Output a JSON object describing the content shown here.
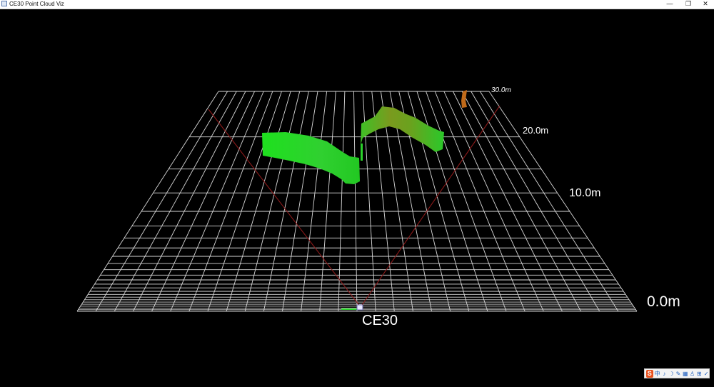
{
  "window": {
    "title": "CE30 Point Cloud Viz",
    "minimize_glyph": "—",
    "maximize_glyph": "❐",
    "close_glyph": "✕"
  },
  "viz": {
    "sensor_label": "CE30",
    "range_labels": [
      "0.0m",
      "10.0m",
      "20.0m",
      "30.0m"
    ],
    "colors": {
      "background": "#000000",
      "grid": "#d8d8d8",
      "fov_lines": "#8b1a1a",
      "points_near": "#22dd22",
      "points_mid": "#6aa81a",
      "points_far": "#c06a1a"
    }
  },
  "ime": {
    "logo": "S",
    "items": [
      "中",
      "♪",
      "☽",
      "✎",
      "▦",
      "♙",
      "⊞",
      "✓"
    ]
  }
}
